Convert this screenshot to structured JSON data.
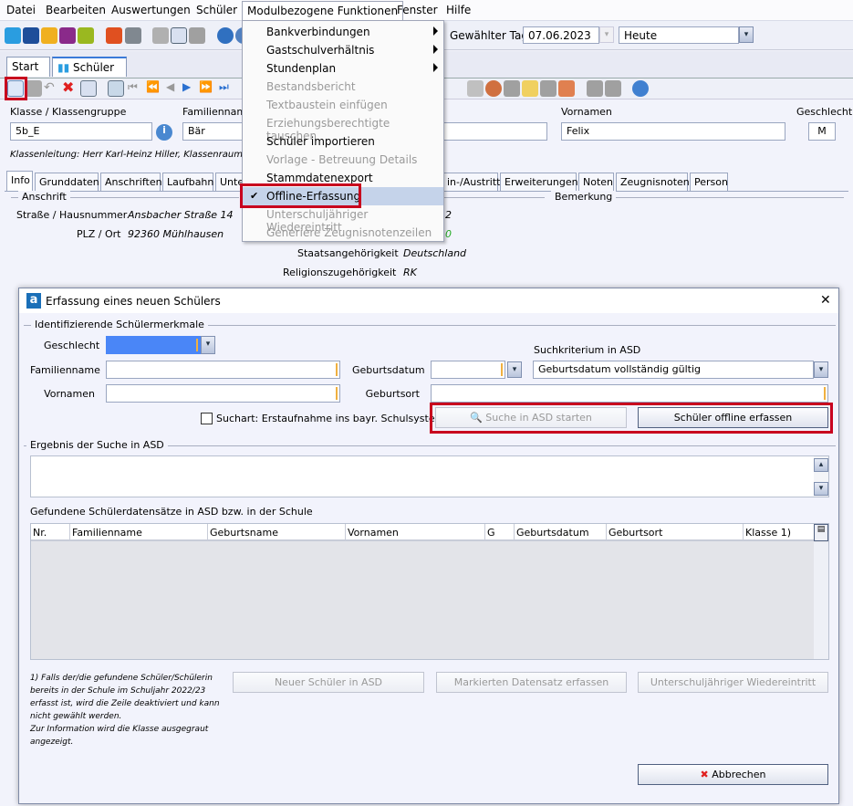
{
  "menubar": {
    "items": [
      "Datei",
      "Bearbeiten",
      "Auswertungen",
      "Schüler",
      "Modulbezogene Funktionen",
      "Fenster",
      "Hilfe"
    ]
  },
  "toolbar": {
    "day_label": "Gewählter Tag",
    "day_value": "07.06.2023",
    "period_value": "Heute"
  },
  "tabs": [
    {
      "label": "Start",
      "close": "✕"
    },
    {
      "label": "Schüler",
      "close": "✕"
    }
  ],
  "student": {
    "klasse_label": "Klasse / Klassengruppe",
    "klasse_value": "5b_E",
    "familienname_label": "Familiennam",
    "familienname_value": "Bär",
    "vornamen_label": "Vornamen",
    "vornamen_value": "Felix",
    "geschlecht_label": "Geschlecht",
    "geschlecht_value": "M",
    "klassenleitung": "Klassenleitung: Herr Karl-Heinz Hiller, Klassenraum: n"
  },
  "subtabs": [
    "Info",
    "Grunddaten",
    "Anschriften",
    "Laufbahn",
    "Unte",
    "in-/Austritt",
    "Erweiterungen",
    "Noten",
    "Zeugnisnoten",
    "Person"
  ],
  "info": {
    "anschrift_label": "Anschrift",
    "bemerkung_label": "Bemerkung",
    "strasse_label": "Straße / Hausnummer",
    "strasse_value": "Ansbacher Straße 14",
    "plz_label": "PLZ / Ort",
    "plz_value": "92360 Mühlhausen",
    "frag1": "2",
    "frag2": "0",
    "staat_label": "Staatsangehörigkeit",
    "staat_value": "Deutschland",
    "religion_label": "Religionszugehörigkeit",
    "religion_value": "RK"
  },
  "menu": {
    "items": [
      {
        "label": "Bankverbindungen",
        "disabled": false,
        "submenu": true
      },
      {
        "label": "Gastschulverhältnis",
        "disabled": false,
        "submenu": true
      },
      {
        "label": "Stundenplan",
        "disabled": false,
        "submenu": true
      },
      {
        "label": "Bestandsbericht",
        "disabled": true
      },
      {
        "label": "Textbaustein einfügen",
        "disabled": true
      },
      {
        "label": "Erziehungsberechtigte tauschen",
        "disabled": true
      },
      {
        "label": "Schüler importieren",
        "disabled": false
      },
      {
        "label": "Vorlage - Betreuung Details",
        "disabled": true
      },
      {
        "label": "Stammdatenexport",
        "disabled": false
      },
      {
        "label": "Offline-Erfassung",
        "disabled": false,
        "checked": true,
        "check": "✔"
      },
      {
        "label": "Unterschuljähriger Wiedereintritt",
        "disabled": true
      },
      {
        "label": "Generiere Zeugnisnotenzeilen",
        "disabled": true
      }
    ]
  },
  "dialog": {
    "title": "Erfassung eines neuen Schülers",
    "app_icon": "a",
    "close": "✕",
    "group1": "Identifizierende Schülermerkmale",
    "geschlecht_label": "Geschlecht",
    "familienname_label": "Familienname",
    "vornamen_label": "Vornamen",
    "geburtsdatum_label": "Geburtsdatum",
    "geburtsort_label": "Geburtsort",
    "suchkriterium_label": "Suchkriterium in ASD",
    "suchkriterium_value": "Geburtsdatum vollständig gültig",
    "suchart_label": "Suchart: Erstaufnahme ins bayr. Schulsystem",
    "suche_button": "Suche in ASD starten",
    "offline_button": "Schüler offline erfassen",
    "group2": "Ergebnis der Suche in ASD",
    "found_label": "Gefundene Schülerdatensätze in ASD bzw. in der Schule",
    "columns": [
      "Nr.",
      "Familienname",
      "Geburtsname",
      "Vornamen",
      "G",
      "Geburtsdatum",
      "Geburtsort",
      "Klasse 1)"
    ],
    "footnote": [
      "1) Falls der/die gefundene Schüler/Schülerin",
      "bereits in der Schule im Schuljahr 2022/23",
      "erfasst ist, wird die Zeile deaktiviert und kann",
      "nicht gewählt werden.",
      "Zur Information wird die Klasse ausgegraut",
      "angezeigt."
    ],
    "neuer_button": "Neuer Schüler in ASD",
    "markierten_button": "Markierten Datensatz erfassen",
    "wiedereintritt_button": "Unterschuljähriger Wiedereintritt",
    "abbrechen_button": "Abbrechen"
  },
  "colors": {
    "highlight": "#c5d3ea",
    "red_box": "#c8001e",
    "selected_field": "#4a86f7"
  }
}
